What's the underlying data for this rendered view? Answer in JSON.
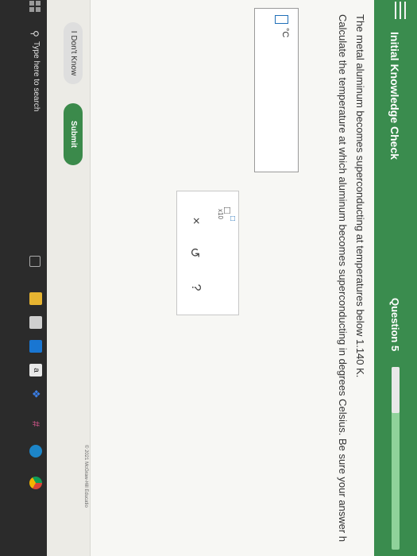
{
  "header": {
    "title": "Initial Knowledge Check",
    "question_label": "Question 5",
    "progress_fraction": 0.25
  },
  "question": {
    "line1": "The metal aluminum becomes superconducting at temperatures below 1.140 K.",
    "line2": "Calculate the temperature at which aluminum becomes superconducting in degrees Celsius. Be sure your answer h"
  },
  "answer": {
    "unit": "°C",
    "value": ""
  },
  "tools": {
    "sci_notation_label": "x10",
    "clear_symbol": "×",
    "undo_symbol": "↺",
    "help_symbol": "?"
  },
  "footer": {
    "dont_know_label": "I Don't Know",
    "submit_label": "Submit",
    "copyright": "© 2021 McGraw-Hill Educatio"
  },
  "taskbar": {
    "search_placeholder": "Type here to search",
    "amazon_glyph": "a",
    "icons": [
      "windows-start-icon",
      "search-icon",
      "task-view-icon",
      "file-explorer-icon",
      "store-icon",
      "mail-icon",
      "amazon-icon",
      "dropbox-icon",
      "slack-icon",
      "edge-icon",
      "chrome-icon"
    ]
  },
  "colors": {
    "header_green": "#3a8c4e",
    "submit_green": "#3b8a4b",
    "accent_blue": "#1f6fb8"
  }
}
